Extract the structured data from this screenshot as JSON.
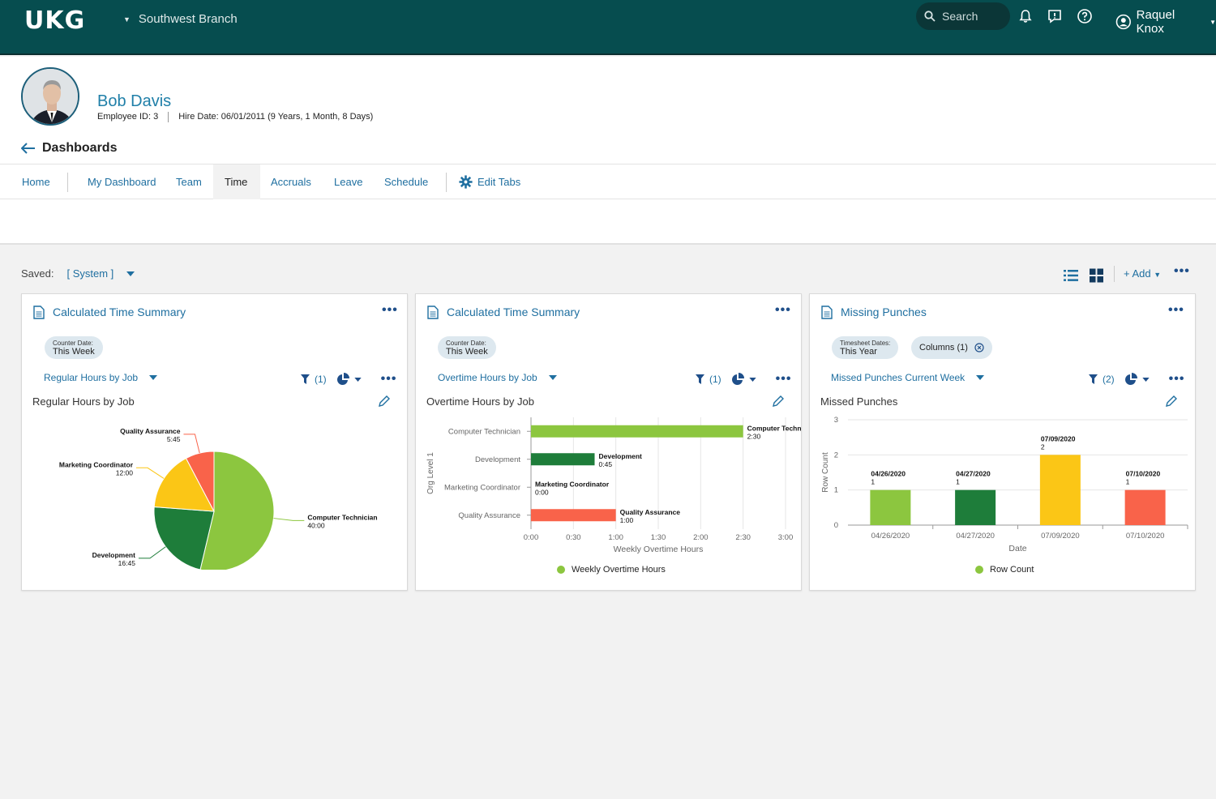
{
  "app": {
    "logo": "UKG",
    "branch": "Southwest Branch",
    "search_label": "Search",
    "user_name": "Raquel Knox"
  },
  "employee": {
    "name": "Bob Davis",
    "employee_id": "Employee ID: 3",
    "hire_date": "Hire Date: 06/01/2011 (9 Years, 1 Month, 8 Days)",
    "back_label": "Dashboards"
  },
  "tabs": [
    {
      "label": "Home"
    },
    {
      "label": "My Dashboard"
    },
    {
      "label": "Team"
    },
    {
      "label": "Time",
      "active": true
    },
    {
      "label": "Accruals"
    },
    {
      "label": "Leave"
    },
    {
      "label": "Schedule"
    },
    {
      "label": "Edit Tabs"
    }
  ],
  "saved": {
    "label": "Saved:",
    "value": "[ System ]",
    "add_label": "+ Add"
  },
  "cards": [
    {
      "title": "Calculated Time Summary",
      "chips": [
        {
          "small": "Counter Date:",
          "big": "This Week"
        }
      ],
      "selector": "Regular Hours by Job",
      "filter": "(1)",
      "subtitle": "Regular Hours by Job"
    },
    {
      "title": "Calculated Time Summary",
      "chips": [
        {
          "small": "Counter Date:",
          "big": "This Week"
        }
      ],
      "selector": "Overtime Hours by Job",
      "filter": "(1)",
      "subtitle": "Overtime Hours by Job",
      "legend": "Weekly Overtime Hours"
    },
    {
      "title": "Missing Punches",
      "chips": [
        {
          "small": "Timesheet Dates:",
          "big": "This Year"
        },
        {
          "single": "Columns (1)"
        }
      ],
      "selector": "Missed Punches Current Week",
      "filter": "(2)",
      "subtitle": "Missed Punches",
      "legend": "Row Count"
    }
  ],
  "chart_data": [
    {
      "type": "pie",
      "categories": [
        "Computer Technician",
        "Development",
        "Marketing Coordinator",
        "Quality Assurance"
      ],
      "values": [
        40,
        16.75,
        12,
        5.75
      ],
      "labels": [
        "40:00",
        "16:45",
        "12:00",
        "5:45"
      ],
      "colors": [
        "#8cc63f",
        "#1e7d3a",
        "#fbc616",
        "#f9634a"
      ]
    },
    {
      "type": "bar",
      "orientation": "horizontal",
      "categories": [
        "Computer Technician",
        "Development",
        "Marketing Coordinator",
        "Quality Assurance"
      ],
      "values": [
        2.5,
        0.75,
        0,
        1
      ],
      "labels": [
        "2:30",
        "0:45",
        "0:00",
        "1:00"
      ],
      "colors": [
        "#8cc63f",
        "#1e7d3a",
        "#fbc616",
        "#f9634a"
      ],
      "xlabel": "Weekly Overtime Hours",
      "ylabel": "Org Level 1",
      "xticks": [
        "0:00",
        "0:30",
        "1:00",
        "1:30",
        "2:00",
        "2:30",
        "3:00"
      ],
      "xlim": [
        0,
        3
      ]
    },
    {
      "type": "bar",
      "categories": [
        "04/26/2020",
        "04/27/2020",
        "07/09/2020",
        "07/10/2020"
      ],
      "values": [
        1,
        1,
        2,
        1
      ],
      "colors": [
        "#8cc63f",
        "#1e7d3a",
        "#fbc616",
        "#f9634a"
      ],
      "xlabel": "Date",
      "ylabel": "Row Count",
      "ylim": [
        0,
        3
      ],
      "yticks": [
        0,
        1,
        2,
        3
      ]
    }
  ]
}
